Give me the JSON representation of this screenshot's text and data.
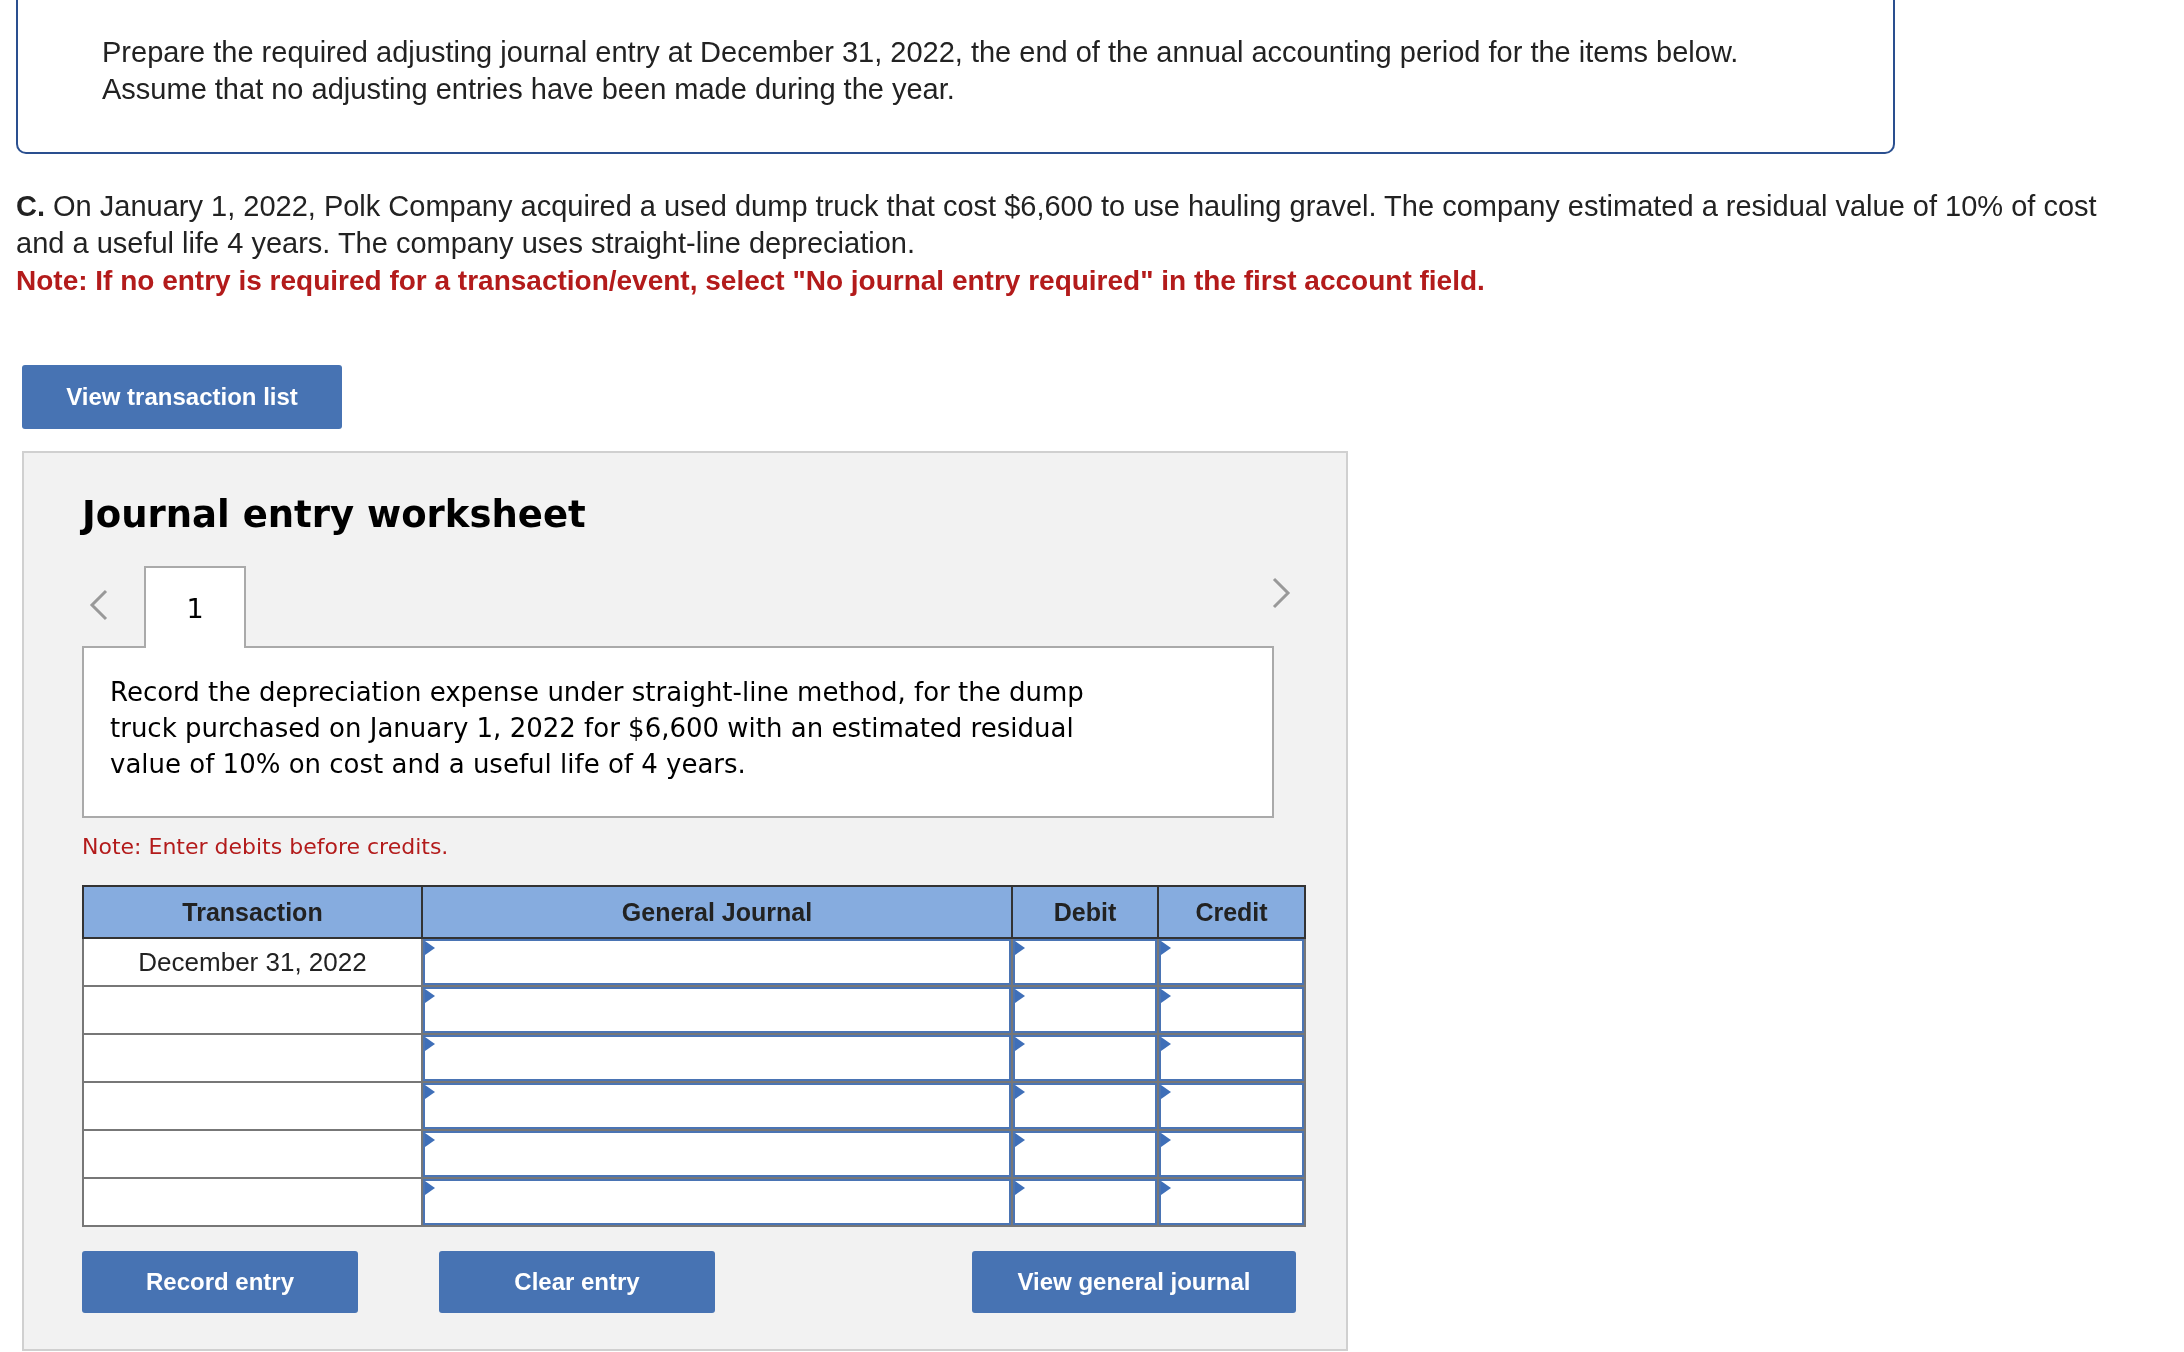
{
  "intro": {
    "text": "Prepare the required adjusting journal entry at December 31, 2022, the end of the annual accounting period for the items below. Assume that no adjusting entries have been made during the year."
  },
  "question": {
    "text": "**C.** On January 1, 2022, Polk Company acquired a used dump truck that cost $6,600 to use hauling gravel. The company estimated a residual value of 10% of cost and a useful life 4 years. The company uses straight-line depreciation.",
    "note": "Note: If no entry is required for a transaction/event, select \"No journal entry required\" in the first account field."
  },
  "list_button": "View transaction list",
  "worksheet": {
    "title": "Journal entry worksheet",
    "tabs": [
      {
        "label": "1",
        "selected": true
      }
    ],
    "description": "Record the depreciation expense under straight-line method, for the dump truck purchased on January 1, 2022 for $6,600 with an estimated residual value of 10% on cost and a useful life of 4 years.",
    "note": "Note: Enter debits before credits.",
    "table": {
      "columns": [
        "Transaction",
        "General Journal",
        "Debit",
        "Credit"
      ],
      "rows": [
        {
          "transaction": "December 31, 2022"
        },
        {},
        {},
        {},
        {},
        {}
      ]
    },
    "buttons": [
      "Record entry",
      "Clear entry",
      "View general journal"
    ]
  }
}
